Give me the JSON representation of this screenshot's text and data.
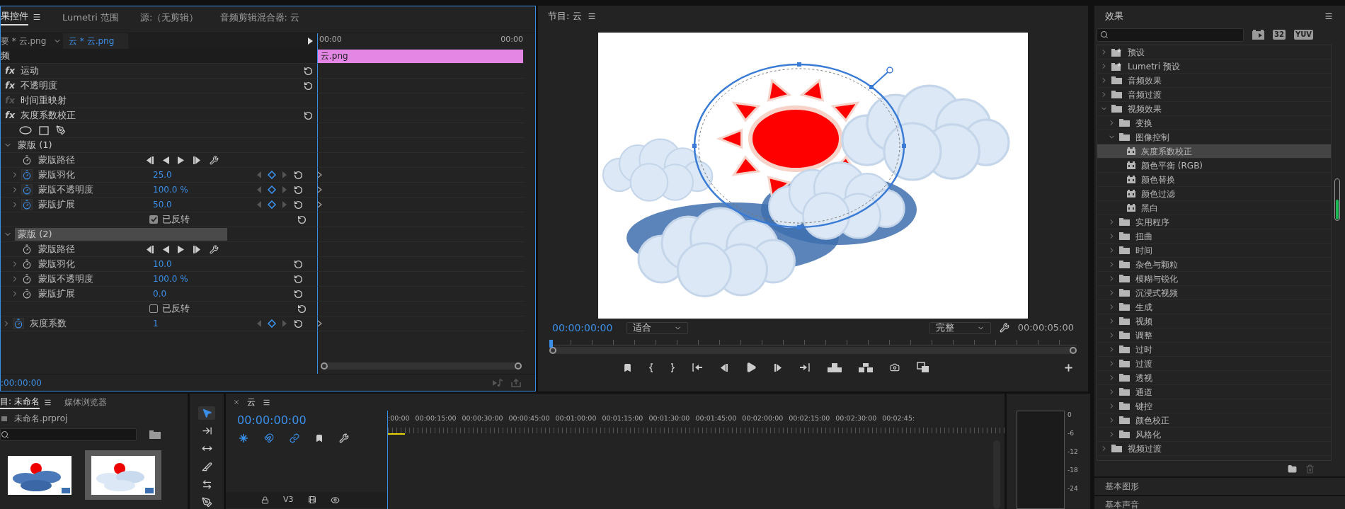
{
  "effect_controls": {
    "tabs": [
      {
        "label": "果控件",
        "selected": true
      },
      {
        "label": "Lumetri 范围",
        "selected": false
      },
      {
        "label": "源:（无剪辑）",
        "selected": false
      },
      {
        "label": "音频剪辑混合器: 云",
        "selected": false
      }
    ],
    "master_clip": "要 * 云.png",
    "sequence_clip": "云 * 云.png",
    "ruler": [
      "00:00",
      "00:00"
    ],
    "clip_bar": "云.png",
    "section": "频",
    "effects": [
      {
        "badge": "fx",
        "name": "运动",
        "enabled": true,
        "resettable": true
      },
      {
        "badge": "fx",
        "name": "不透明度",
        "enabled": true,
        "resettable": true
      },
      {
        "badge": "fx",
        "name": "时间重映射",
        "enabled": false,
        "resettable": false
      },
      {
        "badge": "fx",
        "name": "灰度系数校正",
        "enabled": true,
        "resettable": true,
        "children": [
          {
            "kind": "mask_tools"
          },
          {
            "kind": "mask",
            "label": "蒙版",
            "number": "(1)",
            "expanded": true,
            "selected": false,
            "children": [
              {
                "kind": "path",
                "label": "蒙版路径"
              },
              {
                "kind": "property",
                "label": "蒙版羽化",
                "value": "25.0",
                "animated": true
              },
              {
                "kind": "property",
                "label": "蒙版不透明度",
                "value": "100.0 %",
                "animated": true
              },
              {
                "kind": "property",
                "label": "蒙版扩展",
                "value": "50.0",
                "animated": true
              },
              {
                "kind": "checkbox",
                "label": "已反转",
                "checked": true
              }
            ]
          },
          {
            "kind": "mask",
            "label": "蒙版",
            "number": "(2)",
            "expanded": true,
            "selected": true,
            "children": [
              {
                "kind": "path",
                "label": "蒙版路径"
              },
              {
                "kind": "property",
                "label": "蒙版羽化",
                "value": "10.0",
                "animated": false
              },
              {
                "kind": "property",
                "label": "蒙版不透明度",
                "value": "100.0 %",
                "animated": false
              },
              {
                "kind": "property",
                "label": "蒙版扩展",
                "value": "0.0",
                "animated": false
              },
              {
                "kind": "checkbox",
                "label": "已反转",
                "checked": false
              }
            ]
          },
          {
            "kind": "property",
            "label": "灰度系数",
            "value": "1",
            "animated": true
          }
        ]
      }
    ],
    "timecode": ":00:00:00"
  },
  "program_monitor": {
    "title": "节目: 云",
    "timecode": "00:00:00:00",
    "zoom": "适合",
    "quality": "完整",
    "duration": "00:00:05:00"
  },
  "effects_panel": {
    "title": "效果",
    "filter_buttons": [
      {
        "kind": "icon"
      },
      {
        "kind": "text",
        "label": "32"
      },
      {
        "kind": "text",
        "label": "YUV"
      }
    ],
    "tree": [
      {
        "kind": "preset",
        "label": "预设",
        "expanded": false,
        "selected": false
      },
      {
        "kind": "preset",
        "label": "Lumetri 预设",
        "expanded": false,
        "selected": false
      },
      {
        "kind": "folder",
        "label": "音频效果",
        "expanded": false,
        "selected": false
      },
      {
        "kind": "folder",
        "label": "音频过渡",
        "expanded": false,
        "selected": false
      },
      {
        "kind": "folder",
        "label": "视频效果",
        "expanded": true,
        "selected": false,
        "children": [
          {
            "kind": "folder",
            "label": "变换",
            "expanded": false,
            "selected": false
          },
          {
            "kind": "folder",
            "label": "图像控制",
            "expanded": true,
            "selected": false,
            "children": [
              {
                "kind": "effect",
                "label": "灰度系数校正",
                "selected": true
              },
              {
                "kind": "effect",
                "label": "颜色平衡 (RGB)",
                "selected": false
              },
              {
                "kind": "effect",
                "label": "颜色替换",
                "selected": false
              },
              {
                "kind": "effect",
                "label": "颜色过滤",
                "selected": false
              },
              {
                "kind": "effect",
                "label": "黑白",
                "selected": false
              }
            ]
          },
          {
            "kind": "folder",
            "label": "实用程序",
            "expanded": false,
            "selected": false
          },
          {
            "kind": "folder",
            "label": "扭曲",
            "expanded": false,
            "selected": false
          },
          {
            "kind": "folder",
            "label": "时间",
            "expanded": false,
            "selected": false
          },
          {
            "kind": "folder",
            "label": "杂色与颗粒",
            "expanded": false,
            "selected": false
          },
          {
            "kind": "folder",
            "label": "模糊与锐化",
            "expanded": false,
            "selected": false
          },
          {
            "kind": "folder",
            "label": "沉浸式视频",
            "expanded": false,
            "selected": false
          },
          {
            "kind": "folder",
            "label": "生成",
            "expanded": false,
            "selected": false
          },
          {
            "kind": "folder",
            "label": "视频",
            "expanded": false,
            "selected": false
          },
          {
            "kind": "folder",
            "label": "调整",
            "expanded": false,
            "selected": false
          },
          {
            "kind": "folder",
            "label": "过时",
            "expanded": false,
            "selected": false
          },
          {
            "kind": "folder",
            "label": "过渡",
            "expanded": false,
            "selected": false
          },
          {
            "kind": "folder",
            "label": "透视",
            "expanded": false,
            "selected": false
          },
          {
            "kind": "folder",
            "label": "通道",
            "expanded": false,
            "selected": false
          },
          {
            "kind": "folder",
            "label": "键控",
            "expanded": false,
            "selected": false
          },
          {
            "kind": "folder",
            "label": "颜色校正",
            "expanded": false,
            "selected": false
          },
          {
            "kind": "folder",
            "label": "风格化",
            "expanded": false,
            "selected": false
          }
        ]
      },
      {
        "kind": "folder",
        "label": "视频过渡",
        "expanded": false,
        "selected": false
      }
    ],
    "panels": [
      "基本图形",
      "基本声音"
    ]
  },
  "project": {
    "tabs": [
      {
        "label": "目: 未命名",
        "selected": true
      },
      {
        "label": "媒体浏览器",
        "selected": false
      }
    ],
    "file": "未命名.prproj",
    "thumbnails": [
      {
        "selected": false
      },
      {
        "selected": true
      }
    ]
  },
  "tools": [
    {
      "kind": "selection",
      "selected": true
    },
    {
      "kind": "track_select",
      "selected": false
    },
    {
      "kind": "ripple",
      "selected": false
    },
    {
      "kind": "razor",
      "selected": false
    },
    {
      "kind": "slip",
      "selected": false
    },
    {
      "kind": "pen",
      "selected": false
    }
  ],
  "timeline": {
    "tab": "云",
    "timecode": "00:00:00:00",
    "ruler": [
      ":00:00",
      "00:00:15:00",
      "00:00:30:00",
      "00:00:45:00",
      "00:01:00:00",
      "00:01:15:00",
      "00:01:30:00",
      "00:01:45:00",
      "00:02:00:00",
      "00:02:15:00",
      "00:02:30:00",
      "00:02:45:"
    ],
    "tracks": [
      {
        "label": "V3"
      }
    ]
  },
  "audio_meter": {
    "scale": [
      "0",
      "-6",
      "-12",
      "-18",
      "-24"
    ]
  }
}
